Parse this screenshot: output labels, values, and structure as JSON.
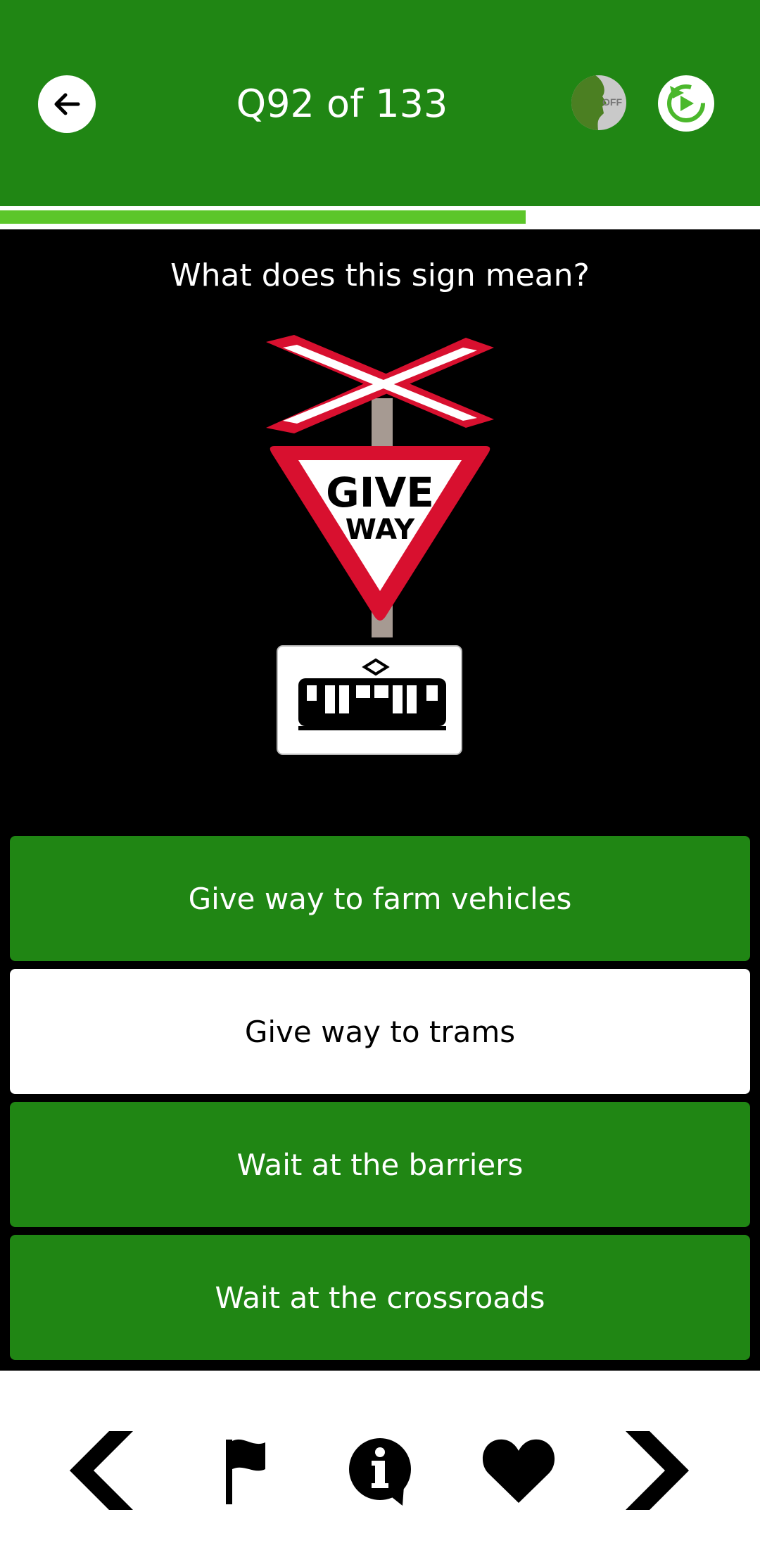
{
  "header": {
    "title": "Q92 of 133",
    "voice_toggle_label": "OFF",
    "back_icon": "arrow-left-icon",
    "reset_icon": "reset-icon"
  },
  "progress": {
    "value": 0.692
  },
  "question": {
    "text": "What does this sign mean?",
    "sign": {
      "top_text": "GIVE",
      "bottom_text": "WAY"
    }
  },
  "answers": [
    {
      "label": "Give way to farm vehicles",
      "state": "default"
    },
    {
      "label": "Give way to trams",
      "state": "selected"
    },
    {
      "label": "Wait at the barriers",
      "state": "default"
    },
    {
      "label": "Wait at the crossroads",
      "state": "default"
    }
  ],
  "bottom_nav": {
    "icons": [
      "chevron-left-icon",
      "flag-icon",
      "info-icon",
      "heart-icon",
      "chevron-right-icon"
    ]
  },
  "colors": {
    "brand_green": "#208614",
    "progress_green": "#5cc62a",
    "sign_red": "#d8102f"
  }
}
